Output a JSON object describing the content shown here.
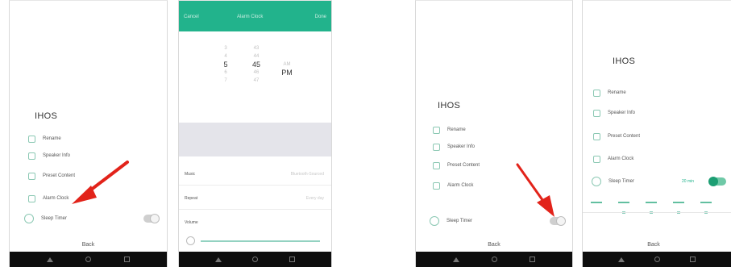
{
  "app_title": "IHOS",
  "menu": {
    "rename": "Rename",
    "speaker_info": "Speaker Info",
    "preset_content": "Preset Content",
    "alarm_clock": "Alarm Clock",
    "sleep_timer": "Sleep Timer",
    "back": "Back"
  },
  "picker_screen": {
    "header": {
      "cancel": "Cancel",
      "title": "Alarm Clock",
      "done": "Done"
    },
    "hours": [
      "3",
      "4",
      "5",
      "6",
      "7"
    ],
    "minutes": [
      "43",
      "44",
      "45",
      "46",
      "47"
    ],
    "ampm": [
      "AM",
      "PM"
    ],
    "selected": {
      "hour": "5",
      "minute": "45",
      "ampm": "PM"
    },
    "rows": [
      {
        "label": "Music",
        "value": "Bluetooth-Sourced"
      },
      {
        "label": "Repeat",
        "value": "Every day"
      },
      {
        "label": "Volume",
        "value": ""
      }
    ],
    "volume_level": 0.9
  },
  "sleep_timer_screen": {
    "enabled": true,
    "current_value": "20 min"
  },
  "colors": {
    "accent": "#22b38c",
    "toggle_on": "#1c9e73",
    "arrow": "#e2231a",
    "navbar": "#0e0e0e"
  }
}
